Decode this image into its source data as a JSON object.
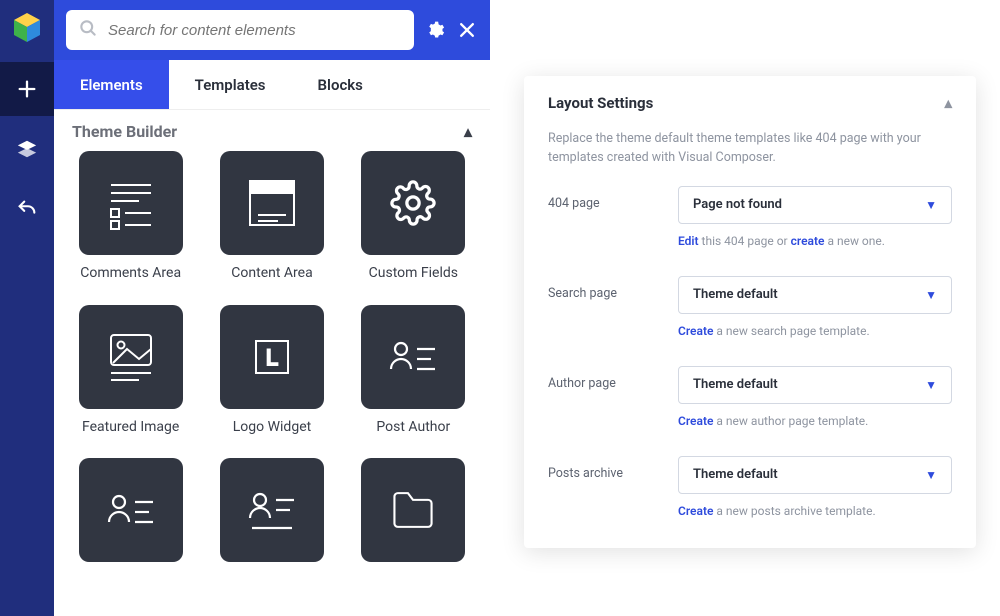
{
  "search": {
    "placeholder": "Search for content elements"
  },
  "tabs": {
    "elements": "Elements",
    "templates": "Templates",
    "blocks": "Blocks"
  },
  "section": {
    "title": "Theme Builder"
  },
  "items": [
    {
      "label": "Comments Area"
    },
    {
      "label": "Content Area"
    },
    {
      "label": "Custom Fields"
    },
    {
      "label": "Featured Image"
    },
    {
      "label": "Logo Widget"
    },
    {
      "label": "Post Author"
    },
    {
      "label": ""
    },
    {
      "label": ""
    },
    {
      "label": ""
    }
  ],
  "panel": {
    "title": "Layout Settings",
    "desc": "Replace the theme default theme templates like 404 page with your templates created with Visual Composer.",
    "rows": {
      "p404": {
        "label": "404 page",
        "value": "Page not found",
        "hint_pre": "Edit",
        "hint_mid": " this 404 page or ",
        "hint_link2": "create",
        "hint_post": " a new one."
      },
      "search": {
        "label": "Search page",
        "value": "Theme default",
        "hint_pre": "Create",
        "hint_post": " a new search page template."
      },
      "author": {
        "label": "Author page",
        "value": "Theme default",
        "hint_pre": "Create",
        "hint_post": " a new author page template."
      },
      "posts": {
        "label": "Posts archive",
        "value": "Theme default",
        "hint_pre": "Create",
        "hint_post": " a new posts archive template."
      }
    }
  }
}
